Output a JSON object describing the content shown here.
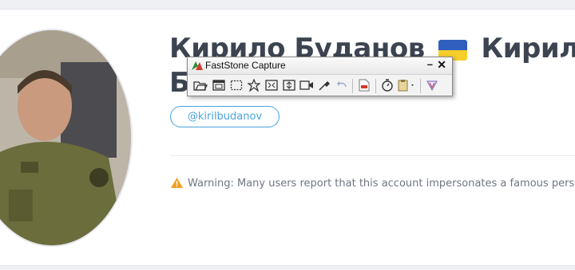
{
  "profile": {
    "name_line1": "Кирило Буданов",
    "flag_icon": "ukraine-flag-icon",
    "name_line1_tail": "Кирилл",
    "name_line2": "Б",
    "handle": "@kirilbudanov",
    "warning_icon": "warning-triangle-icon",
    "warning_text": "Warning: Many users report that this account impersonates a famous perso"
  },
  "faststone": {
    "title": "FastStone Capture",
    "minimize": "–",
    "close": "✕",
    "tools": [
      "open-folder-icon",
      "capture-window-icon",
      "capture-rectangle-icon",
      "capture-freehand-icon",
      "capture-fullscreen-icon",
      "capture-scrolling-icon",
      "screen-recorder-icon",
      "color-picker-icon",
      "undo-icon",
      "pdf-icon",
      "timer-icon",
      "clipboard-output-icon",
      "settings-icon"
    ]
  },
  "colors": {
    "title": "#3d4451",
    "accent": "#4aa3df",
    "warning": "#f0a020",
    "flag_blue": "#2f5fbf",
    "flag_yellow": "#f6cf2a"
  }
}
